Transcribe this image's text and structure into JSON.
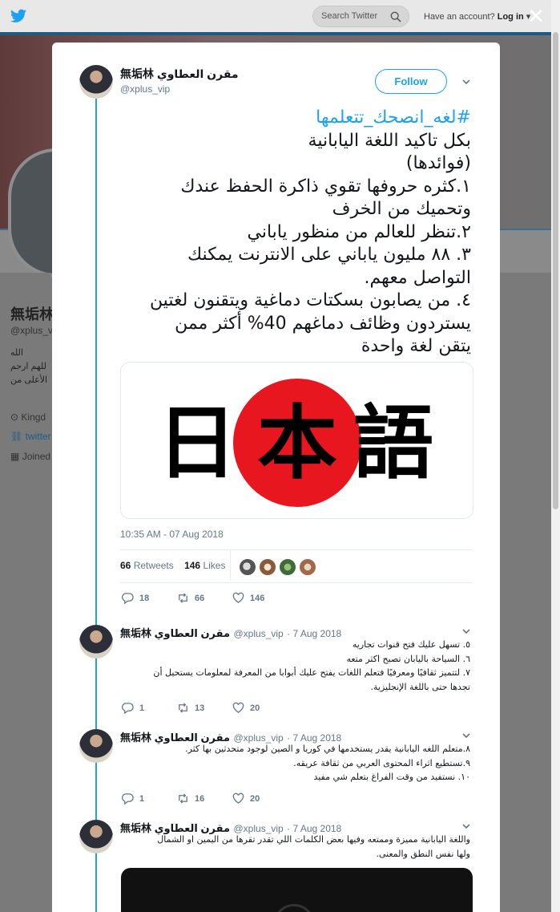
{
  "topbar": {
    "search_placeholder": "Search Twitter",
    "account_prompt": "Have an account?",
    "login_label": "Log in",
    "close_symbol": "✕"
  },
  "profile": {
    "name": "無垢林",
    "handle": "@xplus_v",
    "bio_lines": [
      "الله",
      "للهم ارحم",
      "الأعلى من"
    ],
    "location": "Kingd",
    "website": "twitter",
    "joined": "Joined"
  },
  "tweet": {
    "author_name": "無垢林 مقرن العطاوي",
    "author_handle": "@xplus_vip",
    "follow_label": "Follow",
    "hashtag": "#لغه_انصحك_تتعلمها",
    "body_lines": [
      "بكل تاكيد اللغة اليابانية",
      "(فوائدها)",
      "١.كثره حروفها تقوي ذاكرة الحفظ عندك",
      "وتحميك من الخرف",
      "٢.تنظر للعالم من منظور ياباني",
      "٣. ٨٨ مليون ياباني على الانترنت يمكنك",
      "التواصل معهم.",
      "٤. من يصابون بسكتات دماغية ويتقنون لغتين",
      "يستردون وظائف دماغهم 40% أكثر ممن",
      "يتقن لغة واحدة"
    ],
    "media_text": [
      "日",
      "本",
      "語"
    ],
    "timestamp": "10:35 AM - 07 Aug 2018",
    "retweets_count": "66",
    "retweets_label": "Retweets",
    "likes_count": "146",
    "likes_label": "Likes",
    "reply_count": "18",
    "retweet_count": "66",
    "like_count": "146"
  },
  "replies": [
    {
      "author_name": "無垢林 مقرن العطاوي",
      "author_handle": "@xplus_vip",
      "date": "· 7 Aug 2018",
      "lines": [
        "٥. تسهل عليك فتح قنوات تجاريه",
        "٦. السياحة باليابان تصبح اكثر متعه",
        "٧. لتتميز ثقافيًا ومعرفيًا فتعلم اللغات يفتح عليك أبوابا من المعرفة لمعلومات يستحيل أن",
        "تجدها حتى باللغة الإنجليزية."
      ],
      "reply_count": "1",
      "retweet_count": "13",
      "like_count": "20"
    },
    {
      "author_name": "無垢林 مقرن العطاوي",
      "author_handle": "@xplus_vip",
      "date": "· 7 Aug 2018",
      "lines": [
        "٨.متعلم اللغه اليابانية يقدر يستخدمها في كوريا و الصين لوجود متحدثين بها كثر.",
        "٩.تستطيع اثراء المحتوى العربي من ثقافة عريقه.",
        "١٠. نستفيد من وقت الفراغ بتعلم شي مفيد"
      ],
      "reply_count": "1",
      "retweet_count": "16",
      "like_count": "20"
    },
    {
      "author_name": "無垢林 مقرن العطاوي",
      "author_handle": "@xplus_vip",
      "date": "· 7 Aug 2018",
      "lines": [
        "واللغة اليابانية مميزة وممتعه وفيها بعض الكلمات اللي تقدر تقرها من اليمين او الشمال",
        "ولها نفس النطق والمعنى."
      ]
    }
  ],
  "colors": {
    "accent": "#1da1f2",
    "text": "#14171a",
    "muted": "#657786",
    "flag_red": "#e8161f"
  }
}
